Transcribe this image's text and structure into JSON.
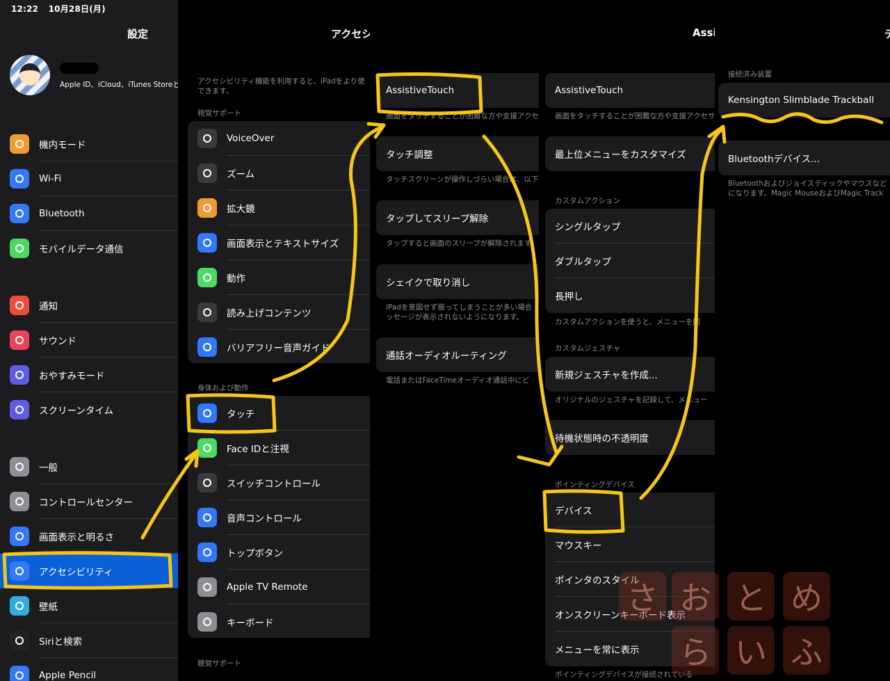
{
  "status_bar": {
    "time": "12:22",
    "date": "10月28日(月)"
  },
  "settings": {
    "title": "設定",
    "profile": {
      "subtitle": "Apple ID、iCloud、iTunes Storeと"
    },
    "group1": [
      {
        "label": "機内モード",
        "icon": "airplane-icon",
        "color": "#f09a37"
      },
      {
        "label": "Wi-Fi",
        "icon": "wifi-icon",
        "color": "#3478f6"
      },
      {
        "label": "Bluetooth",
        "icon": "bluetooth-icon",
        "color": "#3478f6"
      },
      {
        "label": "モバイルデータ通信",
        "icon": "antenna-icon",
        "color": "#4cd964"
      }
    ],
    "group2": [
      {
        "label": "通知",
        "icon": "notification-icon",
        "color": "#eb4d3d"
      },
      {
        "label": "サウンド",
        "icon": "speaker-icon",
        "color": "#eb445a"
      },
      {
        "label": "おやすみモード",
        "icon": "moon-icon",
        "color": "#5e5ce6"
      },
      {
        "label": "スクリーンタイム",
        "icon": "hourglass-icon",
        "color": "#5e5ce6"
      }
    ],
    "group3": [
      {
        "label": "一般",
        "icon": "gear-icon",
        "color": "#8e8e93"
      },
      {
        "label": "コントロールセンター",
        "icon": "switches-icon",
        "color": "#8e8e93"
      },
      {
        "label": "画面表示と明るさ",
        "icon": "text-size-icon",
        "color": "#3478f6"
      },
      {
        "label": "アクセシビリティ",
        "icon": "accessibility-icon",
        "color": "#3478f6",
        "selected": true
      },
      {
        "label": "壁紙",
        "icon": "flower-icon",
        "color": "#35aadc"
      },
      {
        "label": "Siriと検索",
        "icon": "siri-icon",
        "color": "#222"
      },
      {
        "label": "Apple Pencil",
        "icon": "pencil-icon",
        "color": "#3478f6"
      }
    ]
  },
  "accessibility": {
    "title": "アクセシ",
    "intro": "アクセシビリティ機能を利用すると、iPadをより使\nできます。",
    "vision_header": "視覚サポート",
    "vision": [
      {
        "label": "VoiceOver",
        "icon": "voiceover-icon",
        "color": "#3a3a3c"
      },
      {
        "label": "ズーム",
        "icon": "zoom-icon",
        "color": "#3a3a3c"
      },
      {
        "label": "拡大鏡",
        "icon": "magnifier-icon",
        "color": "#f09a37"
      },
      {
        "label": "画面表示とテキストサイズ",
        "icon": "text-size-icon",
        "color": "#3478f6"
      },
      {
        "label": "動作",
        "icon": "motion-icon",
        "color": "#4cd964"
      },
      {
        "label": "読み上げコンテンツ",
        "icon": "speech-icon",
        "color": "#3a3a3c"
      },
      {
        "label": "バリアフリー音声ガイド",
        "icon": "audio-description-icon",
        "color": "#3478f6"
      }
    ],
    "physical_header": "身体および動作",
    "physical": [
      {
        "label": "タッチ",
        "icon": "hand-icon",
        "color": "#3478f6"
      },
      {
        "label": "Face IDと注視",
        "icon": "faceid-icon",
        "color": "#4cd964"
      },
      {
        "label": "スイッチコントロール",
        "icon": "switch-control-icon",
        "color": "#3a3a3c"
      },
      {
        "label": "音声コントロール",
        "icon": "voice-control-icon",
        "color": "#3478f6"
      },
      {
        "label": "トップボタン",
        "icon": "top-button-icon",
        "color": "#3478f6"
      },
      {
        "label": "Apple TV Remote",
        "icon": "remote-icon",
        "color": "#8e8e93"
      },
      {
        "label": "キーボード",
        "icon": "keyboard-icon",
        "color": "#8e8e93"
      }
    ],
    "hearing_header": "聴覚サポート"
  },
  "touch": {
    "rows": [
      {
        "label": "AssistiveTouch",
        "footer": "画面をタッチすることが困難な方や支援アクセ"
      },
      {
        "label": "タッチ調整",
        "footer": "タッチスクリーンが操作しづらい場合は、以下"
      },
      {
        "label": "タップしてスリープ解除",
        "footer": "タップすると画面のスリープが解除されます"
      },
      {
        "label": "シェイクで取り消し",
        "footer": "iPadを意図せず振ってしまうことが多い場合\nッセージが表示されないようになります。"
      },
      {
        "label": "通話オーディオルーティング",
        "footer": "電話またはFaceTimeオーディオ通話中にど"
      }
    ]
  },
  "assistive": {
    "title": "Assi",
    "row1": "AssistiveTouch",
    "row1_footer": "画面をタッチすることが困難な方や支援アクセサ",
    "row2": "最上位メニューをカスタマイズ",
    "custom_actions_header": "カスタムアクション",
    "custom_actions": [
      "シングルタップ",
      "ダブルタップ",
      "長押し"
    ],
    "custom_actions_footer": "カスタムアクションを使うと、メニューを開",
    "custom_gesture_header": "カスタムジェスチャ",
    "new_gesture": "新規ジェスチャを作成...",
    "new_gesture_footer": "オリジナルのジェスチャを記録して、メニュー",
    "idle_opacity": "待機状態時の不透明度",
    "pointing_header": "ポインティングデバイス",
    "pointing": [
      "デバイス",
      "マウスキー",
      "ポインタのスタイル",
      "オンスクリーンキーボード表示",
      "メニューを常に表示"
    ],
    "pointing_footer": "ポインティングデバイスが接続されている"
  },
  "devices": {
    "title": "デ",
    "connected_header": "接続済み装置",
    "device": "Kensington Slimblade Trackball",
    "bt_devices": "Bluetoothデバイス...",
    "footer": "Bluetoothおよびジョイスティックやマウスなど\nになります。Magic MouseおよびMagic Track"
  },
  "watermark": {
    "chars": [
      "さ",
      "お",
      "と",
      "め",
      "ら",
      "い",
      "ふ"
    ]
  },
  "colors": {
    "accent": "#0a60d9",
    "annotation": "#f5c518"
  }
}
